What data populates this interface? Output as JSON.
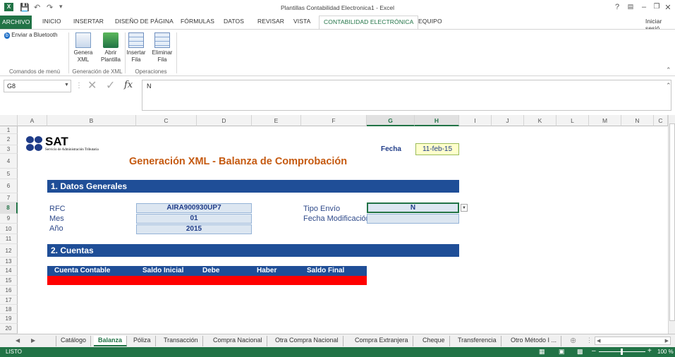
{
  "window": {
    "title": "Plantillas Contabilidad Electronica1 - Excel",
    "help": "?",
    "user": "Iniciar sesió"
  },
  "ribbon_tabs": [
    "ARCHIVO",
    "INICIO",
    "INSERTAR",
    "DISEÑO DE PÁGINA",
    "FÓRMULAS",
    "DATOS",
    "REVISAR",
    "VISTA",
    "CONTABILIDAD ELECTRÓNICA",
    "EQUIPO"
  ],
  "ribbon": {
    "bluetooth": "Enviar a Bluetooth",
    "genera": [
      "Genera",
      "XML"
    ],
    "abrir": [
      "Abrir",
      "Plantilla"
    ],
    "insertar": [
      "Insertar",
      "Fila"
    ],
    "eliminar": [
      "Eliminar",
      "Fila"
    ],
    "groups": [
      "Comandos de menú",
      "Generación de XML",
      "Operaciones"
    ]
  },
  "formula_bar": {
    "name_box": "G8",
    "fx": "fx",
    "value": "N"
  },
  "columns": [
    "A",
    "B",
    "C",
    "D",
    "E",
    "F",
    "G",
    "H",
    "I",
    "J",
    "K",
    "L",
    "M",
    "N",
    "C"
  ],
  "rows": [
    "1",
    "2",
    "3",
    "4",
    "5",
    "6",
    "7",
    "8",
    "9",
    "10",
    "11",
    "12",
    "13",
    "14",
    "15",
    "16",
    "17",
    "18",
    "19",
    "20"
  ],
  "sheet": {
    "logo": "SAT",
    "logo_sub": "Servicio de Administración Tributaria",
    "title": "Generación XML - Balanza de Comprobación",
    "fecha_label": "Fecha",
    "fecha_value": "11-feb-15",
    "section1": "1. Datos Generales",
    "rfc_label": "RFC",
    "rfc_value": "AIRA900930UP7",
    "mes_label": "Mes",
    "mes_value": "01",
    "anio_label": "Año",
    "anio_value": "2015",
    "tipo_label": "Tipo Envío",
    "tipo_value": "N",
    "fecha_mod_label": "Fecha Modificación",
    "section2": "2. Cuentas",
    "table_headers": [
      "Cuenta Contable",
      "Saldo Inicial",
      "Debe",
      "Haber",
      "Saldo Final"
    ]
  },
  "sheet_tabs": [
    "Catálogo",
    "Balanza",
    "Póliza",
    "Transacción",
    "Compra Nacional",
    "Otra Compra Nacional",
    "Compra Extranjera",
    "Cheque",
    "Transferencia",
    "Otro Método I ..."
  ],
  "status": {
    "mode": "LISTO",
    "zoom": "100 %"
  },
  "colors": {
    "accent": "#217346",
    "header_blue": "#1f4e97",
    "title_orange": "#c55a11",
    "red_row": "#ff0000"
  }
}
